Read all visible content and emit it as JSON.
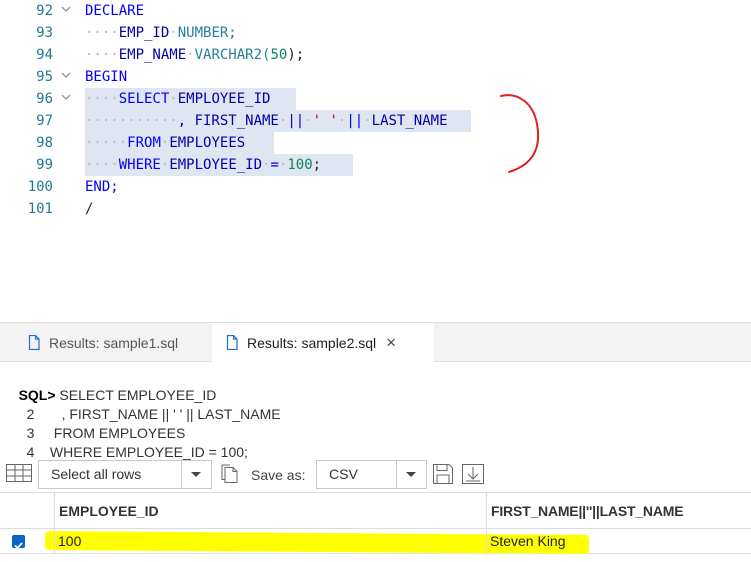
{
  "editor": {
    "lines": [
      {
        "num": "92"
      },
      {
        "num": "93"
      },
      {
        "num": "94"
      },
      {
        "num": "95"
      },
      {
        "num": "96"
      },
      {
        "num": "97"
      },
      {
        "num": "98"
      },
      {
        "num": "99"
      },
      {
        "num": "100"
      },
      {
        "num": "101"
      }
    ],
    "code": {
      "l92": "DECLARE",
      "l93_a": "EMP_ID",
      "l93_b": "NUMBER;",
      "l94_a": "EMP_NAME",
      "l94_b": "VARCHAR2(",
      "l94_c": "50",
      "l94_d": ");",
      "l95": "BEGIN",
      "l96_a": "SELECT",
      "l96_b": "EMPLOYEE_ID",
      "l97_a": ", FIRST_NAME",
      "l97_b": "||",
      "l97_c": "' '",
      "l97_d": "||",
      "l97_e": "LAST_NAME",
      "l98_a": "FROM",
      "l98_b": "EMPLOYEES",
      "l99_a": "WHERE",
      "l99_b": "EMPLOYEE_ID",
      "l99_c": "=",
      "l99_d": "100",
      "l99_e": ";",
      "l100": "END;",
      "l101": "/"
    }
  },
  "tabs": [
    {
      "label": "Results: sample1.sql",
      "active": false
    },
    {
      "label": "Results: sample2.sql",
      "active": true,
      "close": "×"
    }
  ],
  "output": {
    "prompt": "SQL>",
    "lines": [
      {
        "num": "",
        "text": " SELECT EMPLOYEE_ID"
      },
      {
        "num": "2",
        "text": "       , FIRST_NAME || ' ' || LAST_NAME"
      },
      {
        "num": "3",
        "text": "     FROM EMPLOYEES"
      },
      {
        "num": "4",
        "text": "    WHERE EMPLOYEE_ID = 100;"
      }
    ]
  },
  "toolbar": {
    "rows_select": "Select all rows",
    "save_as_label": "Save as:",
    "format_select": "CSV"
  },
  "grid": {
    "columns": [
      "EMPLOYEE_ID",
      "FIRST_NAME||''||LAST_NAME"
    ],
    "rows": [
      {
        "checked": true,
        "cells": [
          "100",
          "Steven King"
        ]
      }
    ]
  },
  "colors": {
    "highlight": "#ffff00",
    "annotation": "#e0201b",
    "keyword": "#0000ff",
    "line_number": "#237893",
    "selection": "#dfe6f1"
  }
}
